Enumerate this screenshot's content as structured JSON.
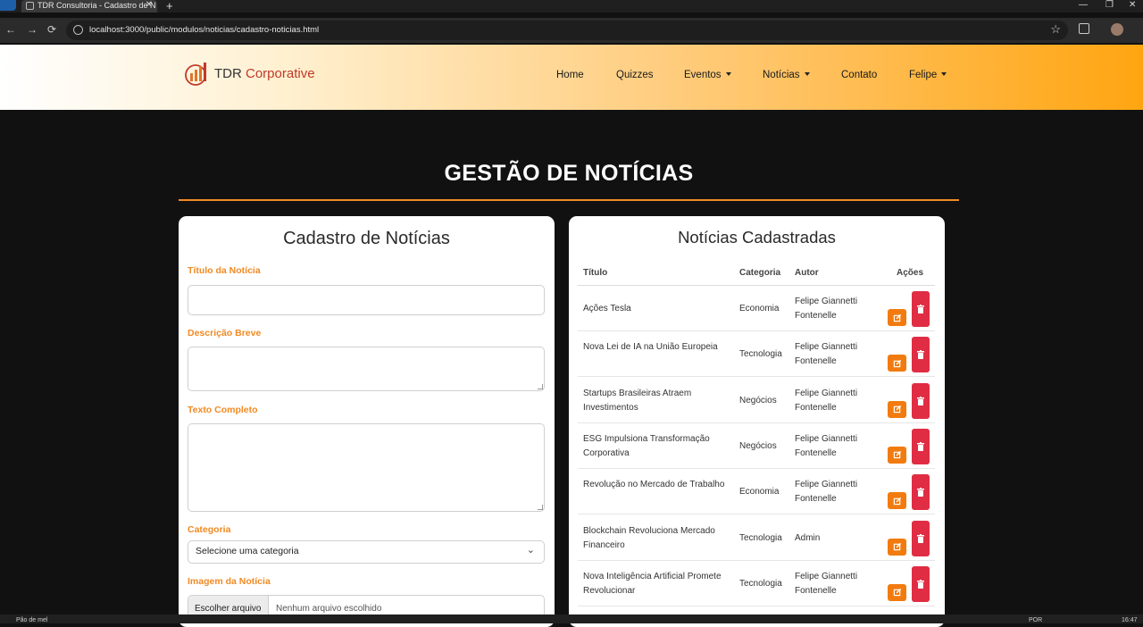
{
  "browser": {
    "tab_title": "TDR Consultoria - Cadastro de N",
    "tab_close": "✕",
    "new_tab": "+",
    "url": "localhost:3000/public/modulos/noticias/cadastro-noticias.html",
    "back": "←",
    "forward": "→",
    "reload": "⟳",
    "minimize": "—",
    "restore": "❐",
    "close": "✕",
    "bookmark": "☆"
  },
  "navbar": {
    "logo_part1": "TDR",
    "logo_part2": "Corporative",
    "links": [
      "Home",
      "Quizzes",
      "Eventos",
      "Notícias",
      "Contato",
      "Felipe"
    ]
  },
  "page": {
    "title": "GESTÃO DE NOTÍCIAS"
  },
  "form": {
    "title": "Cadastro de Notícias",
    "label_titulo": "Título da Notícia",
    "label_descricao": "Descrição Breve",
    "label_texto": "Texto Completo",
    "label_categoria": "Categoria",
    "categoria_selected": "Selecione uma categoria",
    "label_imagem": "Imagem da Notícia",
    "file_button": "Escolher arquivo",
    "file_none": "Nenhum arquivo escolhido"
  },
  "list": {
    "title": "Notícias Cadastradas",
    "headers": [
      "Título",
      "Categoria",
      "Autor",
      "Ações"
    ],
    "rows": [
      {
        "titulo": "Ações Tesla",
        "categoria": "Economia",
        "autor": "Felipe Giannetti Fontenelle"
      },
      {
        "titulo": "Nova Lei de IA na União Europeia",
        "categoria": "Tecnologia",
        "autor": "Felipe Giannetti Fontenelle"
      },
      {
        "titulo": "Startups Brasileiras Atraem Investimentos",
        "categoria": "Negócios",
        "autor": "Felipe Giannetti Fontenelle"
      },
      {
        "titulo": "ESG Impulsiona Transformação Corporativa",
        "categoria": "Negócios",
        "autor": "Felipe Giannetti Fontenelle"
      },
      {
        "titulo": "Revolução no Mercado de Trabalho",
        "categoria": "Economia",
        "autor": "Felipe Giannetti Fontenelle"
      },
      {
        "titulo": "Blockchain Revoluciona Mercado Financeiro",
        "categoria": "Tecnologia",
        "autor": "Admin"
      },
      {
        "titulo": "Nova Inteligência Artificial Promete Revolucionar",
        "categoria": "Tecnologia",
        "autor": "Felipe Giannetti Fontenelle"
      }
    ]
  },
  "colors": {
    "accent": "#f08a24",
    "edit": "#f27b10",
    "delete": "#e02d43",
    "background": "#111111"
  },
  "taskbar": {
    "left_text": "Pão de mel",
    "right_text": "POR",
    "clock": "16:47"
  }
}
